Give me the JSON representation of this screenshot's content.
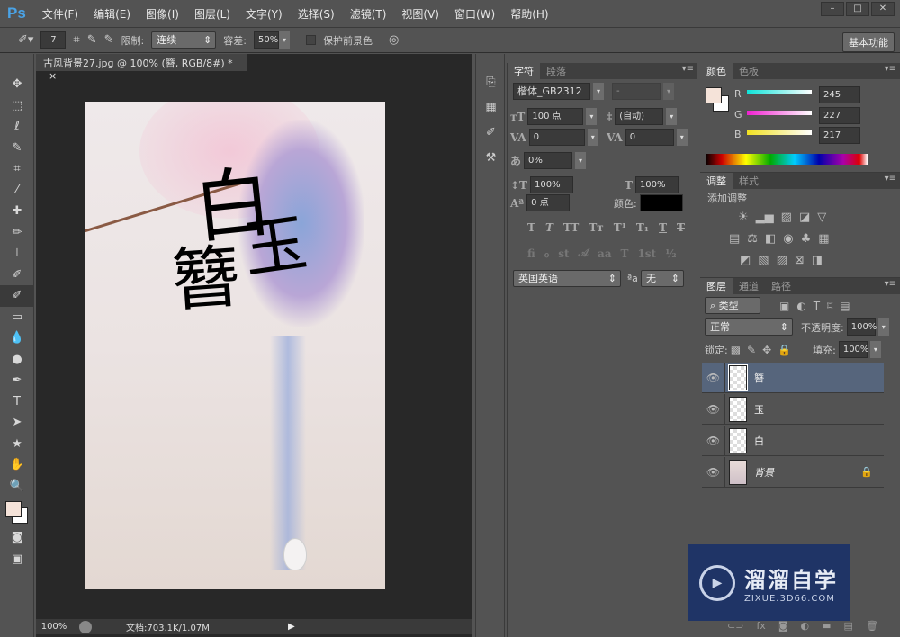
{
  "app": {
    "logo": "Ps"
  },
  "menu": [
    "文件(F)",
    "编辑(E)",
    "图像(I)",
    "图层(L)",
    "文字(Y)",
    "选择(S)",
    "滤镜(T)",
    "视图(V)",
    "窗口(W)",
    "帮助(H)"
  ],
  "window_controls": [
    "–",
    "□",
    "✕"
  ],
  "options": {
    "brush_size": "7",
    "limit_label": "限制:",
    "limit_value": "连续",
    "tolerance_label": "容差:",
    "tolerance_value": "50%",
    "protect_fg_label": "保护前景色",
    "protect_fg_checked": false,
    "workspace": "基本功能"
  },
  "document": {
    "tab_title": "古风背景27.jpg @ 100% (簪, RGB/8#) *",
    "close": "×",
    "canvas_text": [
      "白",
      "玉",
      "簪"
    ]
  },
  "status": {
    "zoom": "100%",
    "doc_info": "文档:703.1K/1.07M"
  },
  "tools": [
    "move",
    "marquee",
    "lasso",
    "quick-select",
    "crop",
    "eyedropper",
    "healing",
    "brush",
    "stamp",
    "history-brush",
    "eraser",
    "gradient",
    "blur",
    "dodge",
    "pen",
    "type",
    "path-select",
    "shape",
    "hand",
    "zoom"
  ],
  "character_panel": {
    "tabs": [
      "字符",
      "段落"
    ],
    "font_family": "楷体_GB2312",
    "font_style": "-",
    "font_size": "100 点",
    "leading": "(自动)",
    "kerning": "0",
    "tracking": "0",
    "tsume": "0%",
    "vertical_scale": "100%",
    "horizontal_scale": "100%",
    "baseline_shift": "0 点",
    "color_label": "颜色:",
    "color": "#000000",
    "style_buttons": [
      "T",
      "T",
      "TT",
      "Tт",
      "T¹",
      "T₁",
      "T",
      "T"
    ],
    "opentype_buttons": [
      "fi",
      "ℴ",
      "st",
      "𝒜",
      "aa",
      "T",
      "1st",
      "½"
    ],
    "language": "英国英语",
    "aa_label": "ªa",
    "antialias": "无"
  },
  "color_panel": {
    "tabs": [
      "颜色",
      "色板"
    ],
    "channels": [
      {
        "label": "R",
        "value": "245"
      },
      {
        "label": "G",
        "value": "227"
      },
      {
        "label": "B",
        "value": "217"
      }
    ],
    "foreground": "#f5e3d9",
    "background": "#ffffff"
  },
  "adjustments_panel": {
    "tabs": [
      "调整",
      "样式"
    ],
    "title": "添加调整"
  },
  "layers_panel": {
    "tabs": [
      "图层",
      "通道",
      "路径"
    ],
    "filter": "类型",
    "blend_mode": "正常",
    "opacity_label": "不透明度:",
    "opacity": "100%",
    "lock_label": "锁定:",
    "fill_label": "填充:",
    "fill": "100%",
    "layers": [
      {
        "name": "簪",
        "selected": true
      },
      {
        "name": "玉",
        "selected": false
      },
      {
        "name": "白",
        "selected": false
      },
      {
        "name": "背景",
        "selected": false,
        "locked": true
      }
    ],
    "footer_icons": [
      "link",
      "fx",
      "mask",
      "adjustment",
      "group",
      "new-layer",
      "delete"
    ]
  },
  "watermark": {
    "brand": "溜溜自学",
    "url": "ZIXUE.3D66.COM"
  }
}
